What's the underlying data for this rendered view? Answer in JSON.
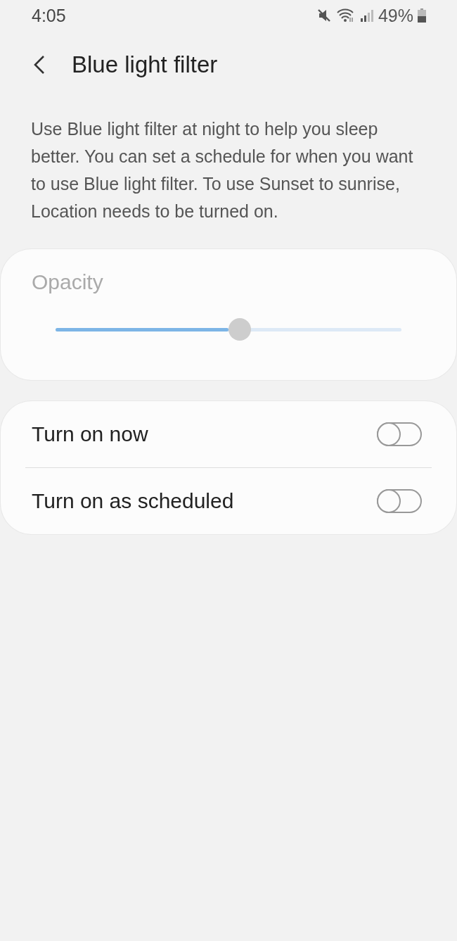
{
  "status_bar": {
    "time": "4:05",
    "battery": "49%"
  },
  "header": {
    "title": "Blue light filter"
  },
  "description": "Use Blue light filter at night to help you sleep better. You can set a schedule for when you want to use Blue light filter. To use Sunset to sunrise, Location needs to be turned on.",
  "opacity": {
    "label": "Opacity",
    "disabled": true,
    "level": 0.5
  },
  "switches": [
    {
      "label": "Turn on now",
      "on": false
    },
    {
      "label": "Turn on as scheduled",
      "on": false
    }
  ]
}
